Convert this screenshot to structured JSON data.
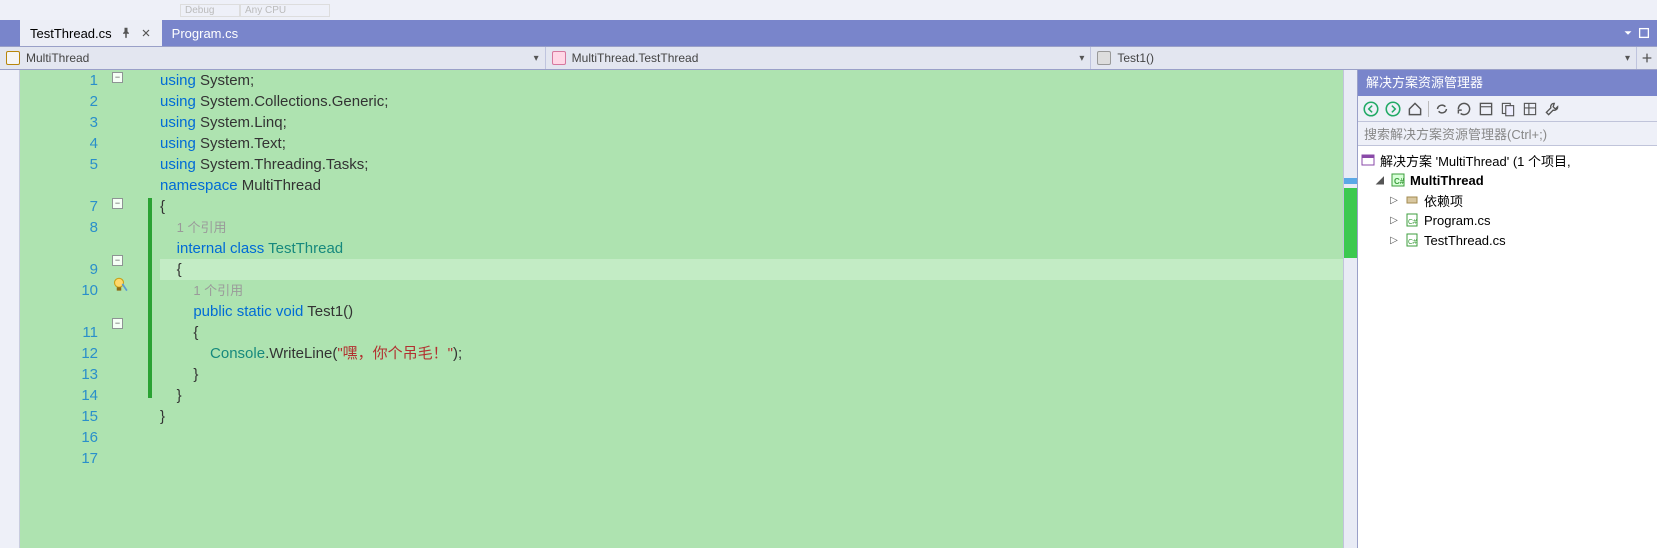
{
  "tabs": [
    {
      "label": "TestThread.cs",
      "active": true,
      "pinned": true
    },
    {
      "label": "Program.cs",
      "active": false,
      "pinned": false
    }
  ],
  "selectors": {
    "project": "MultiThread",
    "namespace": "MultiThread.TestThread",
    "member": "Test1()"
  },
  "solution_explorer": {
    "title": "解决方案资源管理器",
    "search_placeholder": "搜索解决方案资源管理器(Ctrl+;)",
    "root": "解决方案 'MultiThread' (1 个项目,",
    "project": "MultiThread",
    "dep": "依赖项",
    "files": [
      "Program.cs",
      "TestThread.cs"
    ]
  },
  "code": {
    "line_count": 17,
    "current_line": 10,
    "ref1": "1 个引用",
    "ref2": "1 个引用",
    "l1": {
      "kw": "using",
      "rest": " System;"
    },
    "l2": {
      "kw": "using",
      "rest": " System.Collections.Generic;"
    },
    "l3": {
      "kw": "using",
      "rest": " System.Linq;"
    },
    "l4": {
      "kw": "using",
      "rest": " System.Text;"
    },
    "l5": {
      "kw": "using",
      "rest": " System.Threading.Tasks;"
    },
    "l7": {
      "kw": "namespace",
      "name": " MultiThread"
    },
    "l9": {
      "kw": "internal class",
      "name": " TestThread"
    },
    "l11": {
      "kw": "public static void",
      "name": " Test1()"
    },
    "l13": {
      "type": "Console",
      "call": ".WriteLine(",
      "str": "\"嘿，你个吊毛！\"",
      "end": ");"
    }
  }
}
